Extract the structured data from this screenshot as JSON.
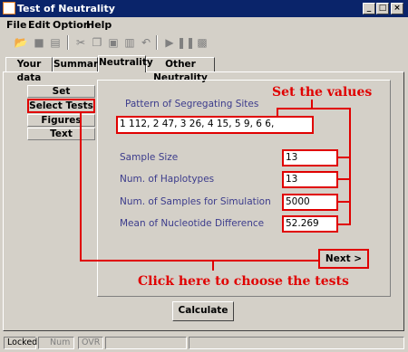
{
  "window": {
    "title": "Test of Neutrality"
  },
  "menu": {
    "file": "File",
    "edit": "Edit",
    "option": "Option",
    "help": "Help"
  },
  "tabs": [
    "Your data",
    "Summary",
    "Neutrality",
    "Other Neutrality"
  ],
  "side_tabs": [
    "Set Parameters",
    "Select Tests",
    "Figures",
    "Text"
  ],
  "form": {
    "pattern_label": "Pattern of Segregating Sites",
    "pattern_value": "1 112, 2 47, 3 26, 4 15, 5 9, 6 6,",
    "sample_size_label": "Sample Size",
    "sample_size_value": "13",
    "haplotypes_label": "Num. of Haplotypes",
    "haplotypes_value": "13",
    "samples_sim_label": "Num. of Samples for Simulation",
    "samples_sim_value": "5000",
    "mean_diff_label": "Mean of Nucleotide Difference",
    "mean_diff_value": "52.269"
  },
  "annotations": {
    "set_values": "Set the values",
    "choose_tests": "Click here to choose the tests"
  },
  "buttons": {
    "next": "Next >",
    "calculate": "Calculate"
  },
  "status": {
    "locked": "Locked",
    "num": "Num",
    "ovr": "OVR"
  },
  "colors": {
    "annotation": "#e00000",
    "titlebar": "#0a246a",
    "label": "#3c3c8c"
  }
}
